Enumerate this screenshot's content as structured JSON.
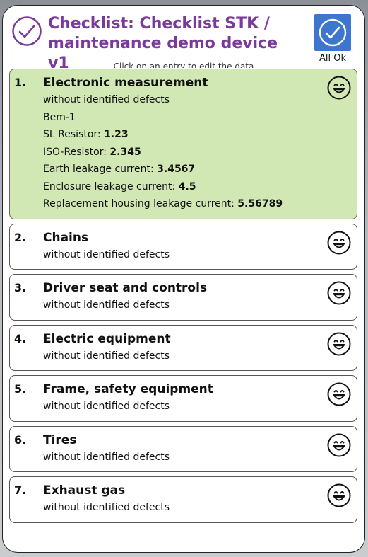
{
  "header": {
    "title": "Checklist: Checklist STK / maintenance demo device v1",
    "all_ok_label": "All Ok",
    "hint": "Click on an entry to edit the data"
  },
  "items": [
    {
      "number": "1.",
      "title": "Electronic measurement",
      "status": "without identified defects",
      "selected": true,
      "icon": "smiley-icon",
      "details": [
        {
          "label": "Bem-1",
          "value": ""
        },
        {
          "label": "SL Resistor: ",
          "value": "1.23"
        },
        {
          "label": "ISO-Resistor: ",
          "value": "2.345"
        },
        {
          "label": "Earth leakage current: ",
          "value": "3.4567"
        },
        {
          "label": "Enclosure leakage current: ",
          "value": "4.5"
        },
        {
          "label": "Replacement housing leakage current: ",
          "value": "5.56789"
        }
      ]
    },
    {
      "number": "2.",
      "title": "Chains",
      "status": "without identified defects",
      "selected": false,
      "icon": "smiley-icon",
      "details": []
    },
    {
      "number": "3.",
      "title": "Driver seat and controls",
      "status": "without identified defects",
      "selected": false,
      "icon": "smiley-icon",
      "details": []
    },
    {
      "number": "4.",
      "title": "Electric equipment",
      "status": "without identified defects",
      "selected": false,
      "icon": "smiley-icon",
      "details": []
    },
    {
      "number": "5.",
      "title": "Frame, safety equipment",
      "status": "without identified defects",
      "selected": false,
      "icon": "smiley-icon",
      "details": []
    },
    {
      "number": "6.",
      "title": "Tires",
      "status": "without identified defects",
      "selected": false,
      "icon": "smiley-icon",
      "details": []
    },
    {
      "number": "7.",
      "title": "Exhaust gas",
      "status": "without identified defects",
      "selected": false,
      "icon": "smiley-icon",
      "details": []
    }
  ],
  "colors": {
    "title": "#7a3a9a",
    "accent": "#3d76cc",
    "selected_bg": "#d2e8b4"
  }
}
